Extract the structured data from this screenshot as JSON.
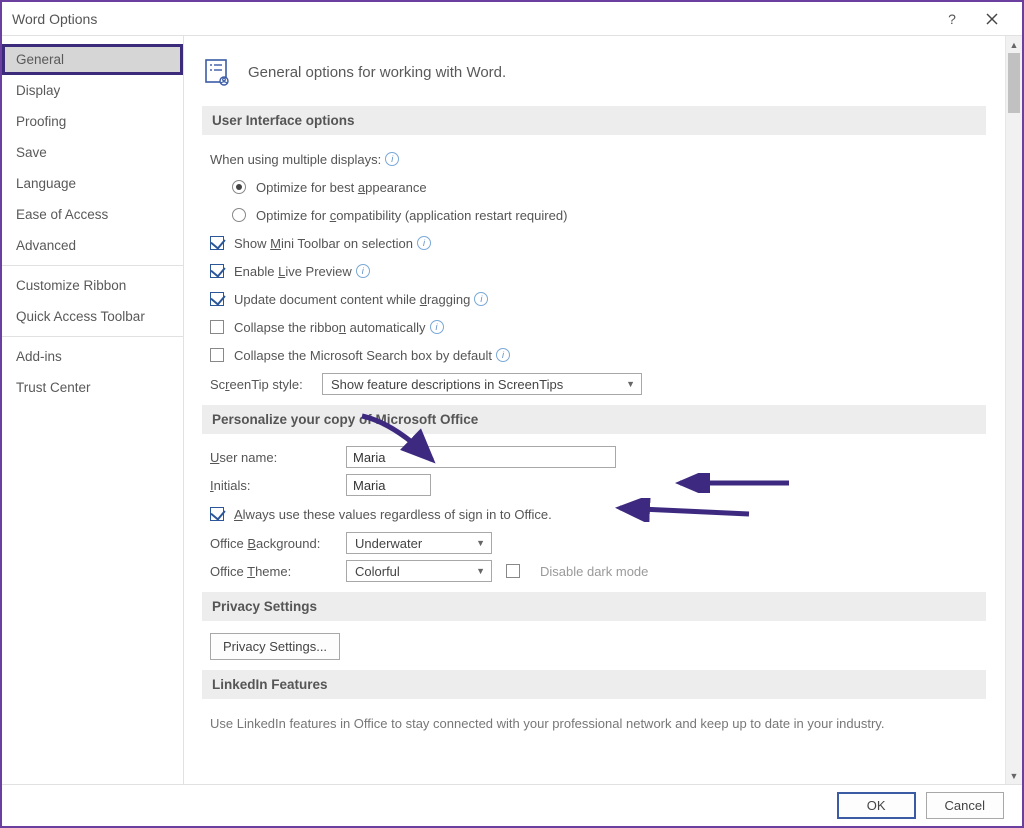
{
  "title": "Word Options",
  "sidebar": {
    "items": [
      {
        "label": "General",
        "selected": true
      },
      {
        "label": "Display"
      },
      {
        "label": "Proofing"
      },
      {
        "label": "Save"
      },
      {
        "label": "Language"
      },
      {
        "label": "Ease of Access"
      },
      {
        "label": "Advanced"
      },
      {
        "sep": true
      },
      {
        "label": "Customize Ribbon"
      },
      {
        "label": "Quick Access Toolbar"
      },
      {
        "sep": true
      },
      {
        "label": "Add-ins"
      },
      {
        "label": "Trust Center"
      }
    ]
  },
  "heading": "General options for working with Word.",
  "sections": {
    "ui": {
      "title": "User Interface options",
      "multiDisplayLabel": "When using multiple displays:",
      "radioBest": "Optimize for best appearance",
      "radioCompat": "Optimize for compatibility (application restart required)",
      "showMini": "Show Mini Toolbar on selection",
      "livePreview": "Enable Live Preview",
      "updateDrag": "Update document content while dragging",
      "collapseRibbon": "Collapse the ribbon automatically",
      "collapseSearch": "Collapse the Microsoft Search box by default",
      "screenTipLabel": "ScreenTip style:",
      "screenTipValue": "Show feature descriptions in ScreenTips"
    },
    "personalize": {
      "title": "Personalize your copy of Microsoft Office",
      "userNameLabel": "User name:",
      "userNameValue": "Maria",
      "initialsLabel": "Initials:",
      "initialsValue": "Maria",
      "alwaysUse": "Always use these values regardless of sign in to Office.",
      "bgLabel": "Office Background:",
      "bgValue": "Underwater",
      "themeLabel": "Office Theme:",
      "themeValue": "Colorful",
      "disableDark": "Disable dark mode"
    },
    "privacy": {
      "title": "Privacy Settings",
      "btn": "Privacy Settings..."
    },
    "linkedin": {
      "title": "LinkedIn Features",
      "desc": "Use LinkedIn features in Office to stay connected with your professional network and keep up to date in your industry."
    }
  },
  "buttons": {
    "ok": "OK",
    "cancel": "Cancel"
  }
}
